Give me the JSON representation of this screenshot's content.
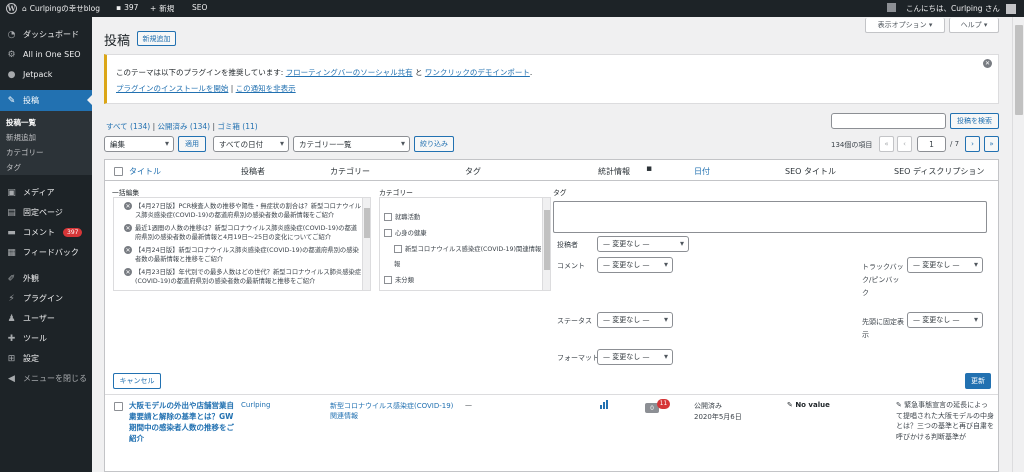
{
  "adminbar": {
    "site_name": "Curlpingの幸せblog",
    "comments_count": "397",
    "new_label": "新規",
    "seo_label": "SEO",
    "greeting": "こんにちは、Curlping さん"
  },
  "sidebar": {
    "items": [
      {
        "label": "ダッシュボード",
        "icon": "dashboard-icon"
      },
      {
        "label": "All in One SEO",
        "icon": "seo-icon"
      },
      {
        "label": "Jetpack",
        "icon": "jetpack-icon"
      },
      {
        "label": "投稿",
        "icon": "pin-icon"
      },
      {
        "label": "メディア",
        "icon": "media-icon"
      },
      {
        "label": "固定ページ",
        "icon": "page-icon"
      },
      {
        "label": "コメント",
        "icon": "comment-icon",
        "badge": "397"
      },
      {
        "label": "フィードバック",
        "icon": "feedback-icon"
      },
      {
        "label": "外観",
        "icon": "appearance-icon"
      },
      {
        "label": "プラグイン",
        "icon": "plugin-icon"
      },
      {
        "label": "ユーザー",
        "icon": "user-icon"
      },
      {
        "label": "ツール",
        "icon": "tool-icon"
      },
      {
        "label": "設定",
        "icon": "settings-icon"
      },
      {
        "label": "メニューを閉じる",
        "icon": "collapse-icon"
      }
    ],
    "submenu": [
      "投稿一覧",
      "新規追加",
      "カテゴリー",
      "タグ"
    ]
  },
  "screen_options": "表示オプション ▾",
  "help": "ヘルプ ▾",
  "page_title": "投稿",
  "add_new": "新規追加",
  "notice": {
    "line1_prefix": "このテーマは以下のプラグインを推奨しています: ",
    "link1": "フローティングバーのソーシャル共有",
    "and": " と ",
    "link2": "ワンクリックのデモインポート",
    "period": ".",
    "install_link": "プラグインのインストールを開始",
    "separator": " | ",
    "dismiss_link": "この通知を非表示"
  },
  "subsubsub": {
    "all": "すべて (134)",
    "published": "公開済み (134)",
    "trash": "ゴミ箱 (11)",
    "sep": " | "
  },
  "search_button": "投稿を検索",
  "filters": {
    "bulk_action": "編集",
    "apply": "適用",
    "dates": "すべての日付",
    "category": "カテゴリー一覧",
    "filter": "絞り込み"
  },
  "pagination": {
    "items": "134個の項目",
    "first": "«",
    "prev": "‹",
    "current": "1",
    "of": "/ 7",
    "next": "›",
    "last": "»"
  },
  "columns": {
    "title": "タイトル",
    "author": "投稿者",
    "categories": "カテゴリー",
    "tags": "タグ",
    "stats": "統計情報",
    "date": "日付",
    "seo_title": "SEO タイトル",
    "seo_desc": "SEO ディスクリプション"
  },
  "bulk_edit": {
    "heading": "一括編集",
    "posts": [
      "【4月27日版】PCR検査人数の推移や陽性・無症状の割合は？新型コロナウイルス肺炎感染症(COVID-19)の都道府県別の感染者数の最新情報をご紹介",
      "最近1週間の人数の推移は？新型コロナウイルス肺炎感染症(COVID-19)の都道府県別の感染者数の最新情報と4月19日〜25日の変化についてご紹介",
      "【4月24日版】新型コロナウイルス肺炎感染症(COVID-19)の都道府県別の感染者数の最新情報と推移をご紹介",
      "【4月23日版】年代別での最多人数はどの世代？新型コロナウイルス肺炎感染症(COVID-19)の都道府県別の感染者数の最新情報と推移をご紹介"
    ],
    "category_heading": "カテゴリー",
    "categories": [
      "就職活動",
      "心身の健康",
      "新型コロナウイルス感染症(COVID-19)関連情報",
      "報",
      "未分類"
    ],
    "tags_heading": "タグ",
    "author_label": "投稿者",
    "comment_label": "コメント",
    "status_label": "ステータス",
    "format_label": "フォーマット",
    "trackback_label": "トラックバック/ピンバック",
    "sticky_label": "先頭に固定表示",
    "no_change": "— 変更なし —",
    "cancel": "キャンセル",
    "update": "更新"
  },
  "row": {
    "title": "大阪モデルの外出や店舗営業自粛要請と解除の基準とは？GW期間中の感染者人数の推移をご紹介",
    "author": "Curlping",
    "category": "新型コロナウイルス感染症(COVID-19)関連情報",
    "tags": "—",
    "comments_pending": "0",
    "comments_count": "11",
    "status": "公開済み",
    "date": "2020年5月6日",
    "seo_title": "No value",
    "seo_desc": "緊急事態宣言の延長によって提唱された大阪モデルの中身とは？三つの基準と再び自粛を呼びかける判断基準が"
  }
}
